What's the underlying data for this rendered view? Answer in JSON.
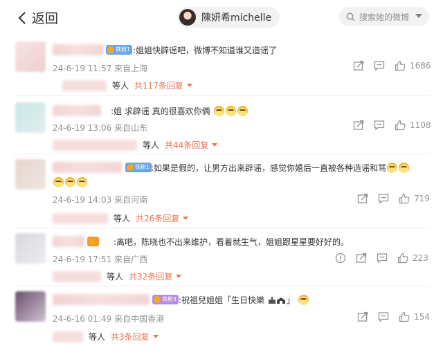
{
  "header": {
    "back_label": "返回",
    "profile_name": "陳妍希michelle",
    "search_placeholder": "搜索她的微博"
  },
  "comments": [
    {
      "badge": "铁粉1",
      "text": ":姐姐快辟谣吧，微博不知道谁又造谣了",
      "time": "24-6-19 11:57",
      "location": "来自上海",
      "likes": "1686",
      "reply_prefix": "等人",
      "reply_count": "共117条回复"
    },
    {
      "badge": "",
      "text": ":姐 求辟谣 真的很喜欢你俩",
      "time": "24-6-19 13:06",
      "location": "来自山东",
      "likes": "1108",
      "reply_prefix": "等人",
      "reply_count": "共44条回复"
    },
    {
      "badge": "铁粉1",
      "text": ":如果是假的，让男方出来辟谣，感觉你婚后一直被各种造谣和骂",
      "time": "24-6-19 14:03",
      "location": "来自河南",
      "likes": "719",
      "reply_prefix": "等人",
      "reply_count": "共26条回复"
    },
    {
      "badge": "",
      "text": ":离吧，陈晓也不出来维护，看着就生气，姐姐跟星星要好好的。",
      "time": "24-6-19 17:51",
      "location": "来自广西",
      "likes": "223",
      "reply_prefix": "等人",
      "reply_count": "共32条回复"
    },
    {
      "badge": "铁粉3",
      "text": ":祝祖兒姐姐「生日快樂",
      "text_tail": "」",
      "time": "24-6-16 01:49",
      "location": "来自中国香港",
      "likes": "154",
      "reply_prefix": "等人",
      "reply_count": "共3条回复"
    }
  ],
  "colors": {
    "accent": "#eb7350",
    "meta": "#939393",
    "badge_blue": "#6aa5e8",
    "badge_orange": "#f39a2b",
    "badge_purple": "#b58ce3"
  }
}
